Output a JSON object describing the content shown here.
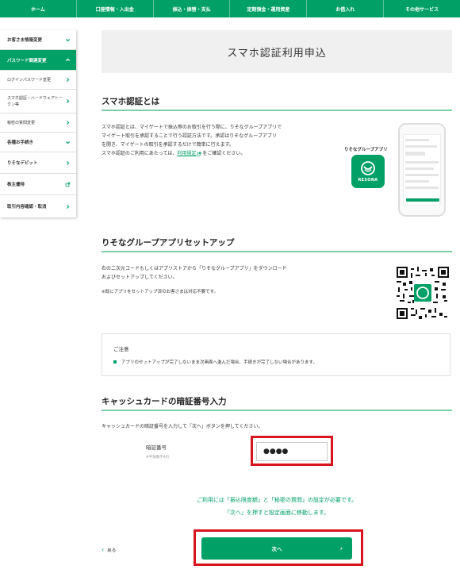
{
  "topnav": {
    "items": [
      "ホーム",
      "口座情報・入出金",
      "振込・振替・支払",
      "定期預金・運用資産",
      "お借入れ",
      "その他サービス"
    ]
  },
  "sidebar": {
    "items": [
      {
        "label": "お客さま情報変更"
      },
      {
        "label": "パスワード関連変更"
      },
      {
        "label": "ログインパスワード変更"
      },
      {
        "label": "スマホ認証・ハードウェアトークン等"
      },
      {
        "label": "秘密の質問変更"
      },
      {
        "label": "各種お手続き"
      },
      {
        "label": "りそなデビット"
      },
      {
        "label": "株主優待"
      },
      {
        "label": "取引内容確認・取消"
      }
    ]
  },
  "page": {
    "title": "スマホ認証利用申込"
  },
  "section1": {
    "heading": "スマホ認証とは",
    "line1": "スマホ認証とは、マイゲートで振込等のお取引を行う際に、りそなグループアプリで",
    "line2": "マイゲート取引を承認することで行う認証方法です。承認はりそなグループアプリ",
    "line3": "を開き、マイゲートの取引を承認するだけで簡単に行えます。",
    "line4_prefix": "スマホ認証のご利用にあたっては、",
    "line4_link": "利用規定",
    "line4_suffix": "をご確認ください。",
    "app_label": "りそなグループアプリ",
    "app_icon_text": "RESONA"
  },
  "section2": {
    "heading": "りそなグループアプリセットアップ",
    "line1": "右の二次元コードもしくはアプリストアから「りそなグループアプリ」をダウンロード",
    "line2": "およびセットアップしてください。",
    "note": "※既にアプリをセットアップ済のお客さまは対応不要です。"
  },
  "notice": {
    "title": "ご注意",
    "item": "アプリのセットアップが完了しないまま次画面へ進んだ場合、手続きが完了しない場合があります。"
  },
  "section3": {
    "heading": "キャッシュカードの暗証番号入力",
    "instruction": "キャッシュカードの暗証番号を入力して「次へ」ボタンを押してください。",
    "pin_label": "暗証番号",
    "pin_sub": "※半角数字4桁",
    "pin_value": "●●●●"
  },
  "footer_note": {
    "line1": "ご利用には「振込限度額」と「秘密の質問」の設定が必要です。",
    "line2": "「次へ」を押すと設定画面に移動します。"
  },
  "buttons": {
    "back": "戻る",
    "next": "次へ"
  },
  "colors": {
    "brand_green": "#00A066",
    "highlight_red": "#D8141E"
  }
}
